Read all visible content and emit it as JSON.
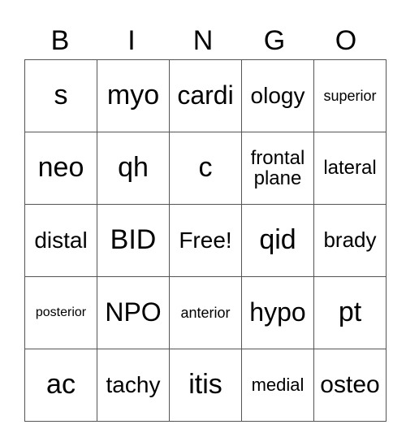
{
  "header": [
    "B",
    "I",
    "N",
    "G",
    "O"
  ],
  "rows": [
    [
      "s",
      "myo",
      "cardi",
      "ology",
      "superior"
    ],
    [
      "neo",
      "qh",
      "c",
      "frontal plane",
      "lateral"
    ],
    [
      "distal",
      "BID",
      "Free!",
      "qid",
      "brady"
    ],
    [
      "posterior",
      "NPO",
      "anterior",
      "hypo",
      "pt"
    ],
    [
      "ac",
      "tachy",
      "itis",
      "medial",
      "osteo"
    ]
  ]
}
